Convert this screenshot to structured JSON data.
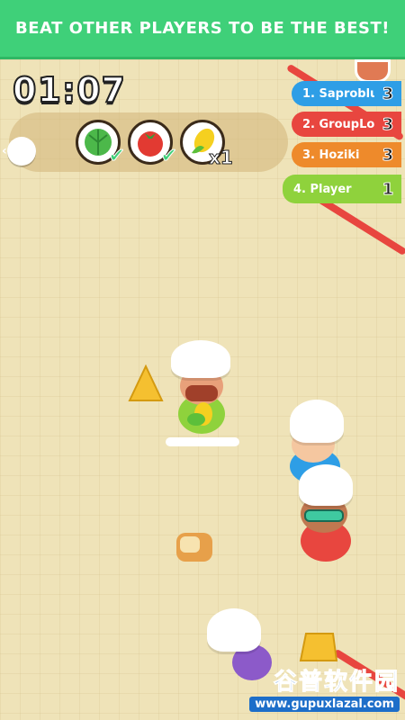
{
  "banner": {
    "text": "BEAT OTHER PLAYERS TO BE THE BEST!"
  },
  "timer": {
    "value": "01:07"
  },
  "order": {
    "items": [
      {
        "icon": "cabbage-icon",
        "done": true
      },
      {
        "icon": "tomato-icon",
        "done": true
      },
      {
        "icon": "corn-icon",
        "done": false
      }
    ],
    "corn_count": "x1"
  },
  "leaderboard": [
    {
      "rank_name": "1. Saproblu",
      "score": "3",
      "color": "#2e9ee6"
    },
    {
      "rank_name": "2. GroupLo",
      "score": "3",
      "color": "#e8463f"
    },
    {
      "rank_name": "3. Hoziki",
      "score": "3",
      "color": "#ee8a2b"
    },
    {
      "rank_name": "4. Player",
      "score": "1",
      "color": "#8fd23c"
    }
  ],
  "watermark": {
    "line1": "谷普软件园",
    "line2": "www.gupuxlazal.com"
  },
  "colors": {
    "banner": "#3fd079",
    "check": "#3fd079"
  }
}
